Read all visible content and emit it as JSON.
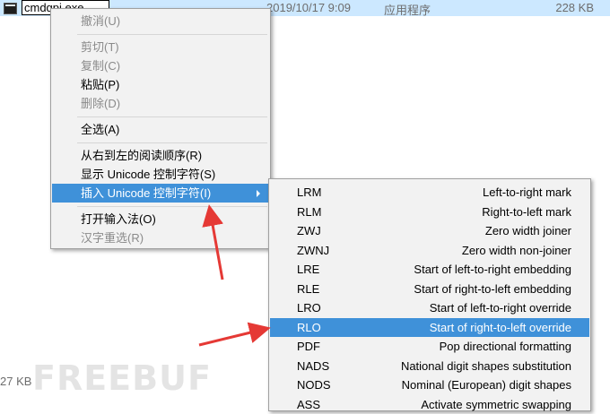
{
  "file": {
    "rename_value": "cmdqpi.exe",
    "date": "2019/10/17 9:09",
    "type": "应用程序",
    "size": "228 KB",
    "bottom_size": "27 KB"
  },
  "context_menu": {
    "items": [
      {
        "label": "撤消(U)",
        "disabled": true
      },
      {
        "label": "剪切(T)",
        "disabled": true
      },
      {
        "label": "复制(C)",
        "disabled": true
      },
      {
        "label": "粘贴(P)",
        "disabled": false
      },
      {
        "label": "删除(D)",
        "disabled": true
      },
      {
        "label": "全选(A)",
        "disabled": false
      },
      {
        "label": "从右到左的阅读顺序(R)",
        "disabled": false
      },
      {
        "label": "显示 Unicode 控制字符(S)",
        "disabled": false
      },
      {
        "label": "插入 Unicode 控制字符(I)",
        "disabled": false,
        "highlighted": true
      },
      {
        "label": "打开输入法(O)",
        "disabled": false
      },
      {
        "label": "汉字重选(R)",
        "disabled": true
      }
    ]
  },
  "unicode_submenu": {
    "items": [
      {
        "code": "LRM",
        "desc": "Left-to-right mark"
      },
      {
        "code": "RLM",
        "desc": "Right-to-left mark"
      },
      {
        "code": "ZWJ",
        "desc": "Zero width joiner"
      },
      {
        "code": "ZWNJ",
        "desc": "Zero width non-joiner"
      },
      {
        "code": "LRE",
        "desc": "Start of left-to-right embedding"
      },
      {
        "code": "RLE",
        "desc": "Start of right-to-left embedding"
      },
      {
        "code": "LRO",
        "desc": "Start of left-to-right override"
      },
      {
        "code": "RLO",
        "desc": "Start of right-to-left override",
        "highlighted": true
      },
      {
        "code": "PDF",
        "desc": "Pop directional formatting"
      },
      {
        "code": "NADS",
        "desc": "National digit shapes substitution"
      },
      {
        "code": "NODS",
        "desc": "Nominal (European) digit shapes"
      },
      {
        "code": "ASS",
        "desc": "Activate symmetric swapping"
      }
    ]
  },
  "watermark": "FREEBUF",
  "colors": {
    "selection_row": "#cce8ff",
    "menu_highlight": "#3f91d9",
    "annotation_arrow": "#e53935"
  }
}
